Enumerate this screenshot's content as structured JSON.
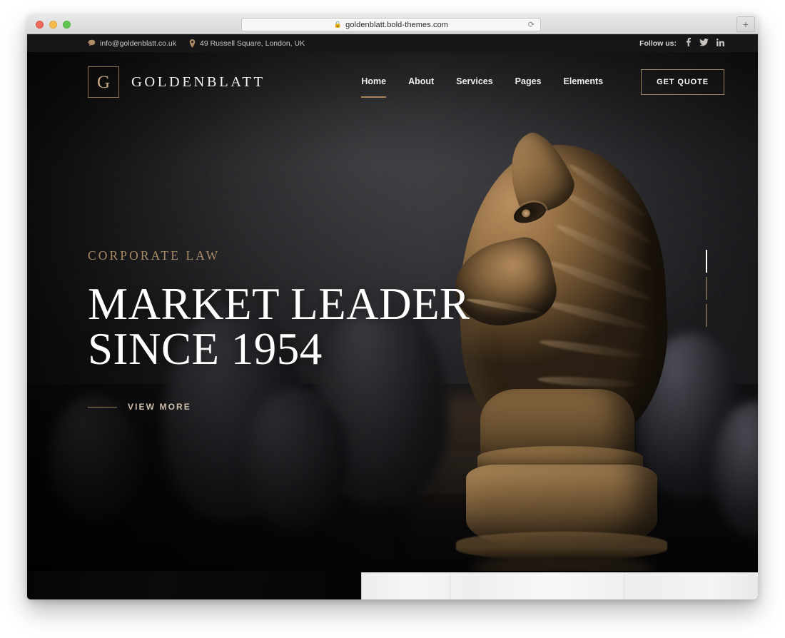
{
  "browser": {
    "url": "goldenblatt.bold-themes.com",
    "lock_icon": "lock-icon",
    "reload_icon": "reload-icon",
    "new_tab_label": "+",
    "traffic_lights": [
      "close",
      "minimize",
      "maximize"
    ]
  },
  "topbar": {
    "email_icon": "chat-bubble-icon",
    "email": "info@goldenblatt.co.uk",
    "location_icon": "map-pin-icon",
    "address": "49 Russell Square, London, UK",
    "follow_label": "Follow us:",
    "social": [
      {
        "name": "facebook-icon",
        "glyph": "f"
      },
      {
        "name": "twitter-icon",
        "glyph": "t"
      },
      {
        "name": "linkedin-icon",
        "glyph": "in"
      }
    ]
  },
  "header": {
    "logo_mark": "G",
    "logo_text": "GOLDENBLATT",
    "nav": [
      {
        "label": "Home",
        "active": true
      },
      {
        "label": "About",
        "active": false
      },
      {
        "label": "Services",
        "active": false
      },
      {
        "label": "Pages",
        "active": false
      },
      {
        "label": "Elements",
        "active": false
      }
    ],
    "cta_label": "GET QUOTE"
  },
  "hero": {
    "eyebrow": "CORPORATE LAW",
    "title_line1": "MARKET LEADER",
    "title_line2": "SINCE 1954",
    "cta_label": "VIEW MORE",
    "slides": [
      {
        "index": 1,
        "active": true
      },
      {
        "index": 2,
        "active": false
      },
      {
        "index": 3,
        "active": false
      }
    ]
  },
  "colors": {
    "gold": "#a98457",
    "gold_light": "#c4a781",
    "topbar_bg": "#17171a",
    "hero_bg": "#2c2c2f",
    "text_white": "#ffffff"
  }
}
